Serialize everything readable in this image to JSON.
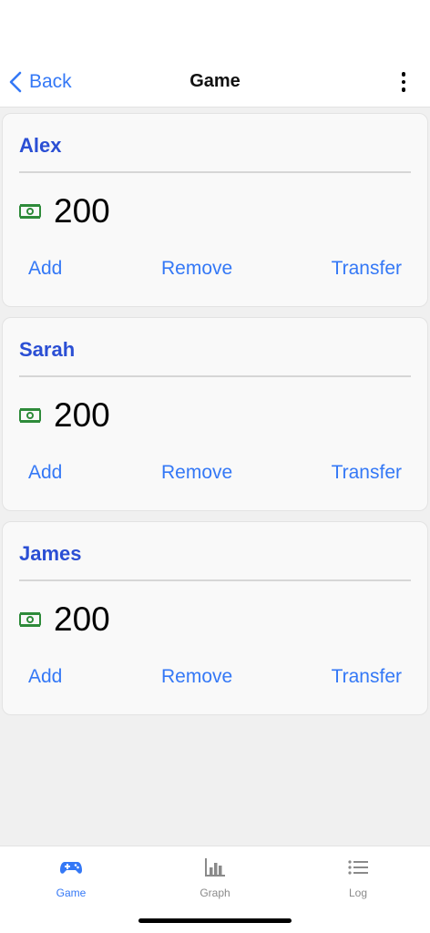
{
  "nav": {
    "back_label": "Back",
    "title": "Game",
    "more_icon": "more-vertical-icon"
  },
  "players": [
    {
      "name": "Alex",
      "balance": "200",
      "actions": {
        "add": "Add",
        "remove": "Remove",
        "transfer": "Transfer"
      }
    },
    {
      "name": "Sarah",
      "balance": "200",
      "actions": {
        "add": "Add",
        "remove": "Remove",
        "transfer": "Transfer"
      }
    },
    {
      "name": "James",
      "balance": "200",
      "actions": {
        "add": "Add",
        "remove": "Remove",
        "transfer": "Transfer"
      }
    }
  ],
  "tabs": [
    {
      "label": "Game",
      "icon": "gamepad-icon",
      "active": true
    },
    {
      "label": "Graph",
      "icon": "bar-chart-icon",
      "active": false
    },
    {
      "label": "Log",
      "icon": "list-icon",
      "active": false
    }
  ],
  "colors": {
    "accent": "#3478f6",
    "player_name": "#2b4fd4",
    "money_icon": "#2e8b3a"
  }
}
